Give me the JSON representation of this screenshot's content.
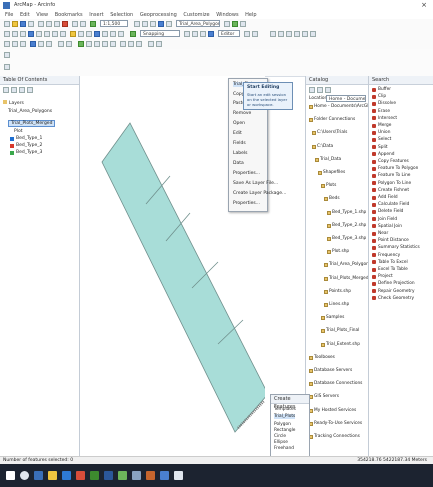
{
  "app": {
    "title": "ArcMap - Arcinfo",
    "close_glyph": "×"
  },
  "menu": [
    "File",
    "Edit",
    "View",
    "Bookmarks",
    "Insert",
    "Selection",
    "Geoprocessing",
    "Customize",
    "Windows",
    "Help"
  ],
  "toolbar": {
    "scale_value": "1:1,500",
    "layer_combo": "Trial_Area_Polygons",
    "snapping_label": "Snapping",
    "editor_label": "Editor"
  },
  "toc": {
    "title": "Table Of Contents",
    "layers": [
      "Layers",
      "Trial_Area_Polygons",
      "Trial_Plots_Merged",
      "Plot",
      "Bed_Type_1",
      "Bed_Type_2",
      "Bed_Type_3"
    ]
  },
  "context_menu": {
    "items": [
      "Trial_Plots",
      "Copy",
      "Paste",
      "Remove",
      "Open",
      "Edit",
      "Fields",
      "Labels",
      "Data",
      "Properties...",
      "Save As Layer File...",
      "Create Layer Package...",
      "Properties..."
    ]
  },
  "tooltip": {
    "title": "Start Editing",
    "lines": [
      "Start an edit session",
      "on the selected layer",
      "or workspace."
    ]
  },
  "catalog": {
    "title": "Catalog",
    "location": "Location:",
    "home": "Home - Documents\\ArcGIS",
    "items": [
      "Home - Documents\\ArcGIS",
      "Folder Connections",
      "C:\\Users\\Trials",
      "C:\\Data",
      "Trial_Data",
      "Shapefiles",
      "Plots",
      "Beds",
      "Bed_Type_1.shp",
      "Bed_Type_2.shp",
      "Bed_Type_3.shp",
      "Plot.shp",
      "Trial_Area_Polygons.shp",
      "Trial_Plots_Merged.shp",
      "Points.shp",
      "Lines.shp",
      "Samples",
      "Trial_Plots_Final",
      "Trial_Extent.shp",
      "Toolboxes",
      "Database Servers",
      "Database Connections",
      "GIS Servers",
      "My Hosted Services",
      "Ready-To-Use Services",
      "Tracking Connections"
    ]
  },
  "search": {
    "title": "Search",
    "items": [
      "Buffer",
      "Clip",
      "Dissolve",
      "Erase",
      "Intersect",
      "Merge",
      "Union",
      "Select",
      "Split",
      "Append",
      "Copy Features",
      "Feature To Polygon",
      "Feature To Line",
      "Polygon To Line",
      "Create Fishnet",
      "Add Field",
      "Calculate Field",
      "Delete Field",
      "Join Field",
      "Spatial Join",
      "Near",
      "Point Distance",
      "Summary Statistics",
      "Frequency",
      "Table To Excel",
      "Excel To Table",
      "Project",
      "Define Projection",
      "Repair Geometry",
      "Check Geometry"
    ]
  },
  "editor_window": {
    "title": "Create Features",
    "items": [
      "Templates",
      "Trial_Plots",
      "Polygon",
      "Rectangle",
      "Circle",
      "Ellipse",
      "Freehand"
    ]
  },
  "status": {
    "left": "Number of features selected: 0",
    "right": "354218.76  5422187.34 Meters"
  },
  "colors": {
    "plot_fill": "#a8ddd8",
    "plot_stroke": "#6f8f8c",
    "accent": "#3a6fb8"
  }
}
